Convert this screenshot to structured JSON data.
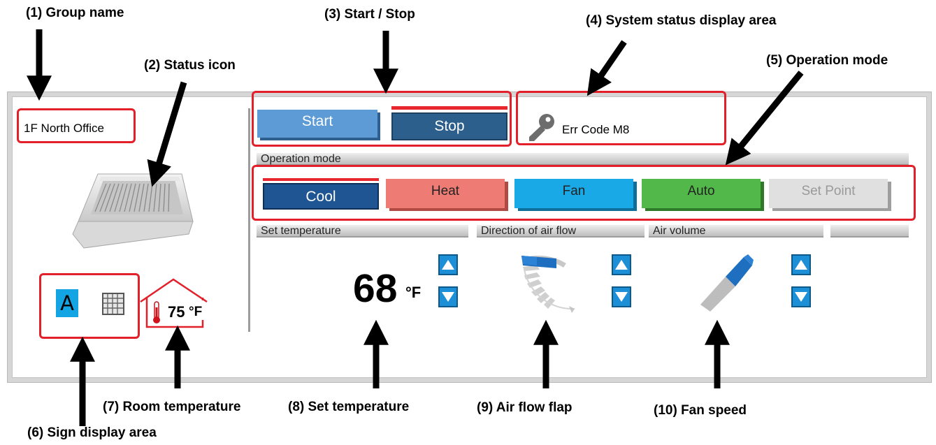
{
  "callouts": {
    "c1": "(1) Group name",
    "c2": "(2) Status icon",
    "c3": "(3) Start / Stop",
    "c4": "(4) System status display area",
    "c5": "(5) Operation mode",
    "c6": "(6) Sign display area",
    "c7": "(7) Room temperature",
    "c8": "(8) Set temperature",
    "c9": "(9) Air flow flap",
    "c10": "(10) Fan speed"
  },
  "panel": {
    "group_name": "1F North Office",
    "start_label": "Start",
    "stop_label": "Stop",
    "status_text": "Err Code M8",
    "operation_mode_header": "Operation mode",
    "modes": {
      "cool": "Cool",
      "heat": "Heat",
      "fan": "Fan",
      "auto": "Auto",
      "set_point": "Set Point"
    },
    "set_temperature_header": "Set temperature",
    "air_flow_header": "Direction of air flow",
    "air_volume_header": "Air volume",
    "set_temperature_value": "68",
    "set_temperature_unit": "°F",
    "sign_letter": "A",
    "room_temperature_value": "75",
    "room_temperature_unit": "°F"
  },
  "colors": {
    "highlight_box": "#e3202a",
    "start": "#5c9bd5",
    "stop": "#2d5f8c",
    "cool": "#1e5592",
    "heat": "#ee7b74",
    "fan": "#19a9e6",
    "auto": "#52b84a",
    "set_point": "#e0e0e0",
    "sign_a": "#12a4e3"
  },
  "icons": {
    "status": "ceiling-cassette-unit-icon",
    "system_status": "key-icon",
    "sign_grid": "filter-grid-icon",
    "room_temp": "thermometer-house-icon",
    "air_flow": "flap-direction-icon",
    "fan_speed": "fan-speed-icon",
    "increment": "up-triangle-icon",
    "decrement": "down-triangle-icon"
  }
}
